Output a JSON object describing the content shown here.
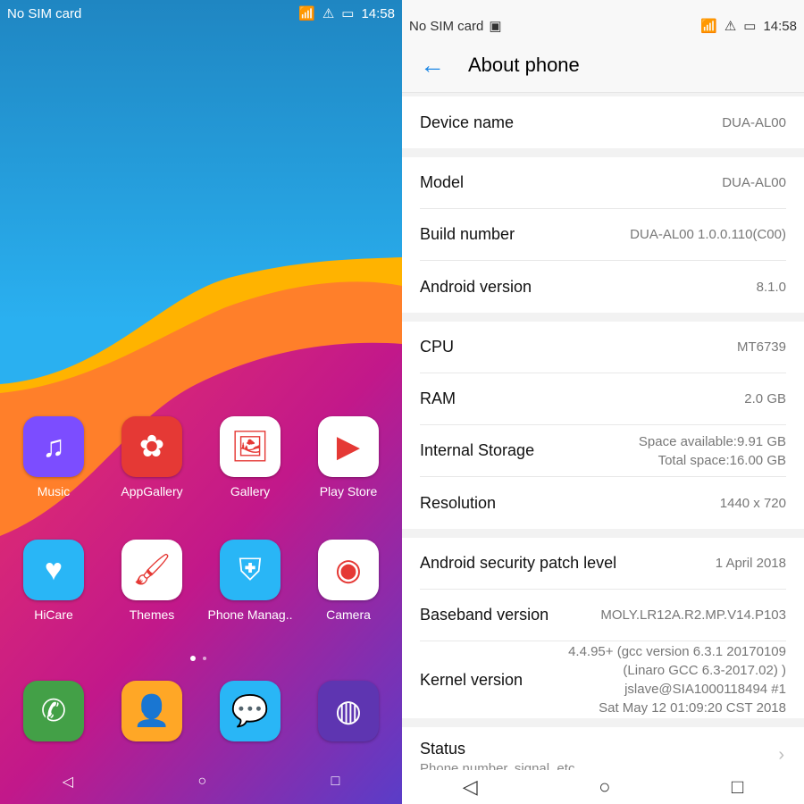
{
  "home": {
    "status": {
      "carrier": "No SIM card",
      "time": "14:58"
    },
    "apps": [
      {
        "label": "Music",
        "icon": "music-note",
        "color": "#7c4dff"
      },
      {
        "label": "AppGallery",
        "icon": "huawei-logo",
        "color": "#e53935"
      },
      {
        "label": "Gallery",
        "icon": "photo",
        "color": "#ffffff"
      },
      {
        "label": "Play Store",
        "icon": "play-triangle",
        "color": "#ffffff"
      },
      {
        "label": "HiCare",
        "icon": "heart-hand",
        "color": "#29b6f6"
      },
      {
        "label": "Themes",
        "icon": "paintbrush",
        "color": "#ffffff"
      },
      {
        "label": "Phone Manag..",
        "icon": "shield",
        "color": "#29b6f6"
      },
      {
        "label": "Camera",
        "icon": "camera-lens",
        "color": "#ffffff"
      }
    ],
    "dock": [
      {
        "icon": "phone",
        "color": "#43a047"
      },
      {
        "icon": "contacts",
        "color": "#ffa726"
      },
      {
        "icon": "message",
        "color": "#29b6f6"
      },
      {
        "icon": "browser",
        "color": "#5e35b1"
      }
    ]
  },
  "settings": {
    "status": {
      "carrier": "No SIM card",
      "time": "14:58"
    },
    "title": "About phone",
    "accent": "#1e88e5",
    "groups": [
      [
        {
          "label": "Device name",
          "value": "DUA-AL00"
        }
      ],
      [
        {
          "label": "Model",
          "value": "DUA-AL00"
        },
        {
          "label": "Build number",
          "value": "DUA-AL00 1.0.0.110(C00)"
        },
        {
          "label": "Android version",
          "value": "8.1.0"
        }
      ],
      [
        {
          "label": "CPU",
          "value": "MT6739"
        },
        {
          "label": "RAM",
          "value": "2.0 GB"
        },
        {
          "label": "Internal Storage",
          "value": "Space available:9.91 GB",
          "value2": "Total space:16.00 GB"
        },
        {
          "label": "Resolution",
          "value": "1440 x 720"
        }
      ],
      [
        {
          "label": "Android security patch level",
          "value": "1 April 2018"
        },
        {
          "label": "Baseband version",
          "value": "MOLY.LR12A.R2.MP.V14.P103"
        },
        {
          "label": "Kernel version",
          "value": "4.4.95+ (gcc version 6.3.1 20170109",
          "value2": "(Linaro GCC 6.3-2017.02) )",
          "value3": "jslave@SIA1000118494 #1",
          "value4": "Sat May 12 01:09:20 CST 2018"
        }
      ]
    ],
    "status_item": {
      "label": "Status",
      "sub": "Phone number, signal, etc."
    }
  }
}
